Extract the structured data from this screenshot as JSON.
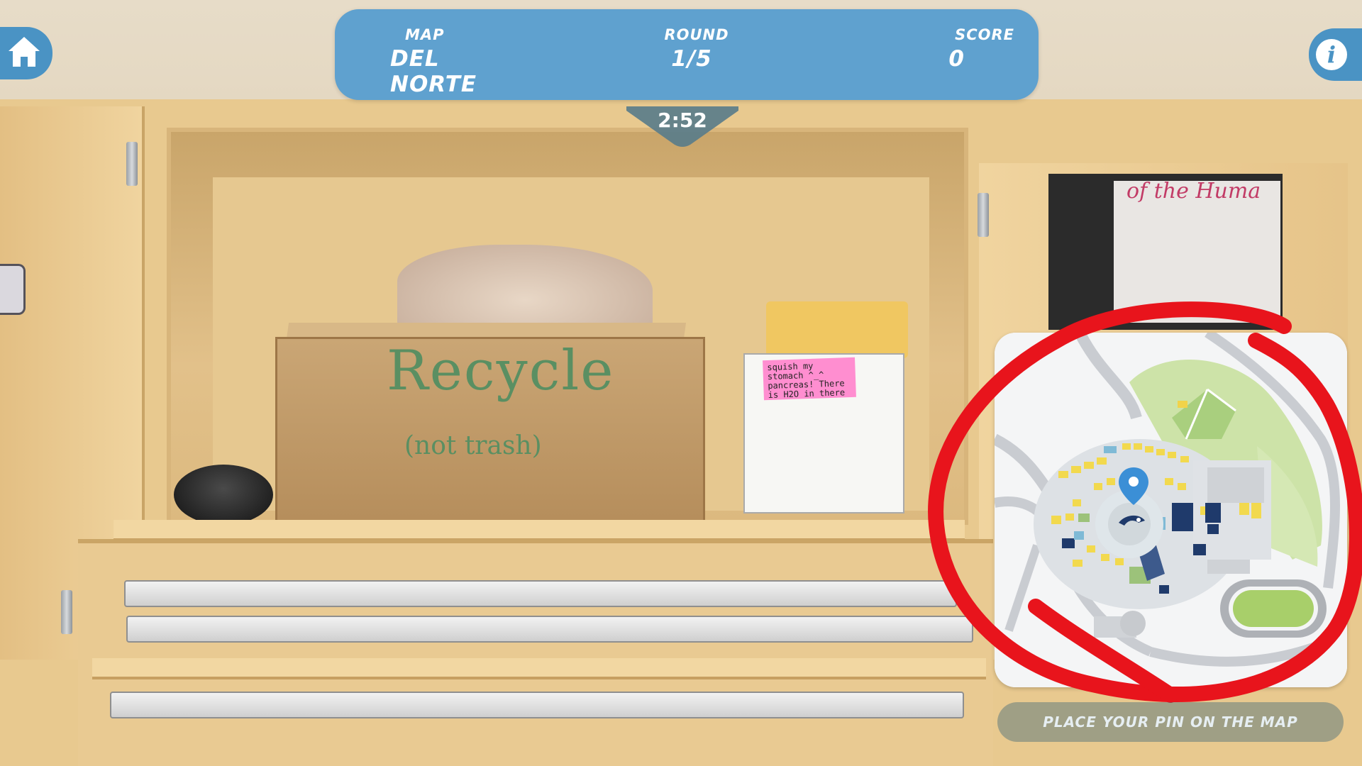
{
  "hud": {
    "map_label": "MAP",
    "map_value": "DEL NORTE",
    "round_label": "ROUND",
    "round_value": "1/5",
    "score_label": "SCORE",
    "score_value": "0",
    "timer": "2:52"
  },
  "buttons": {
    "home_icon": "home-icon",
    "info_glyph": "i",
    "place_pin_label": "PLACE YOUR PIN ON THE MAP"
  },
  "photo_text": {
    "box_line_1": "Recycle",
    "box_line_2": "(not trash)",
    "sticky_note": "squish my stomach ^_^ pancreas! There is H2O in there",
    "poster_title": "of the Huma"
  },
  "colors": {
    "hud_blue": "#5fa1cf",
    "button_blue": "#4a93c4",
    "pin_blue": "#3b8fd6",
    "annotation_red": "#e8141c"
  }
}
